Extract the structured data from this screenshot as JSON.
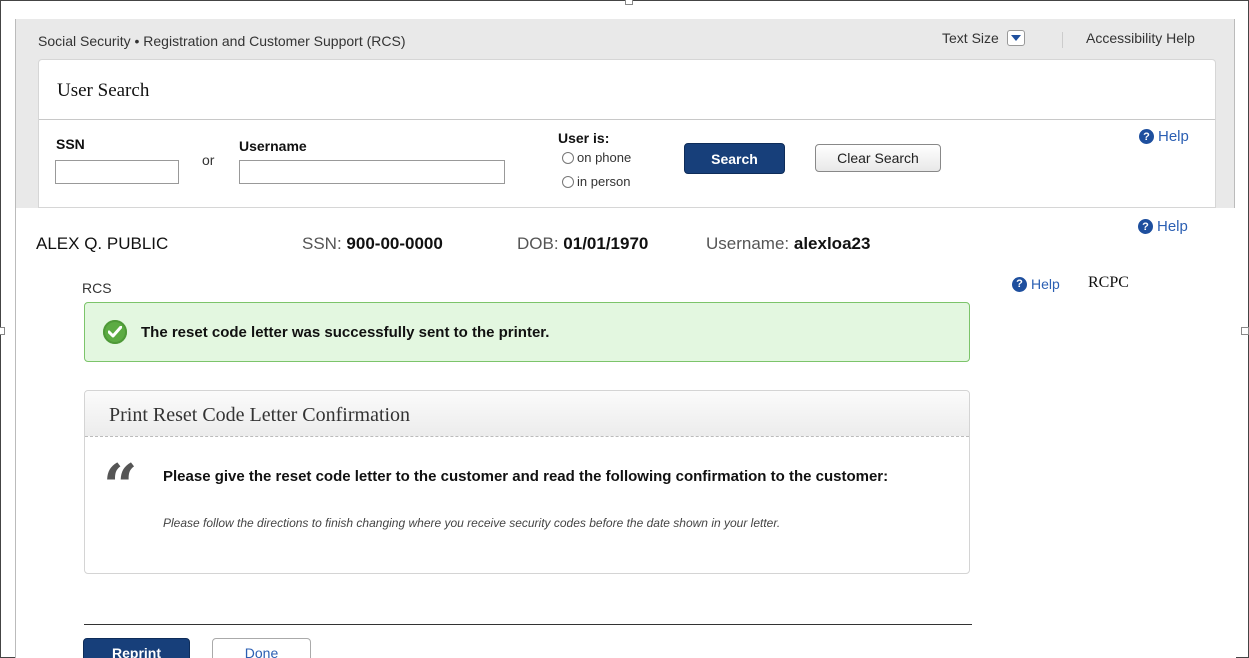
{
  "header": {
    "site_title": "Social Security • Registration and Customer Support (RCS)",
    "text_size_label": "Text Size",
    "accessibility_help": "Accessibility Help"
  },
  "search": {
    "title": "User Search",
    "ssn_label": "SSN",
    "or_label": "or",
    "username_label": "Username",
    "ssn_value": "",
    "username_value": "",
    "user_is_label": "User is:",
    "options": [
      "on phone",
      "in person"
    ],
    "search_button": "Search",
    "clear_button": "Clear Search",
    "help": "Help"
  },
  "customer": {
    "name": "ALEX Q. PUBLIC",
    "ssn_label": "SSN:",
    "ssn": "900-00-0000",
    "dob_label": "DOB:",
    "dob": "01/01/1970",
    "username_label": "Username:",
    "username": "alexloa23",
    "help": "Help"
  },
  "section": {
    "rcs_label": "RCS",
    "help": "Help",
    "rcpc_label": "RCPC"
  },
  "alert": {
    "message": "The reset code letter was successfully sent to the printer."
  },
  "confirmation": {
    "title": "Print Reset Code Letter Confirmation",
    "quote_mark": "“",
    "instruction": "Please give the reset code letter to the customer and read the following confirmation to the customer:",
    "script": "Please follow the directions to finish changing where you receive security codes before the date shown in your letter."
  },
  "actions": {
    "reprint": "Reprint",
    "done": "Done"
  },
  "colors": {
    "primary_button": "#173f7a",
    "success_bg": "#e3f7e0",
    "success_border": "#7cc46a",
    "help_blue": "#1e4f9e"
  }
}
